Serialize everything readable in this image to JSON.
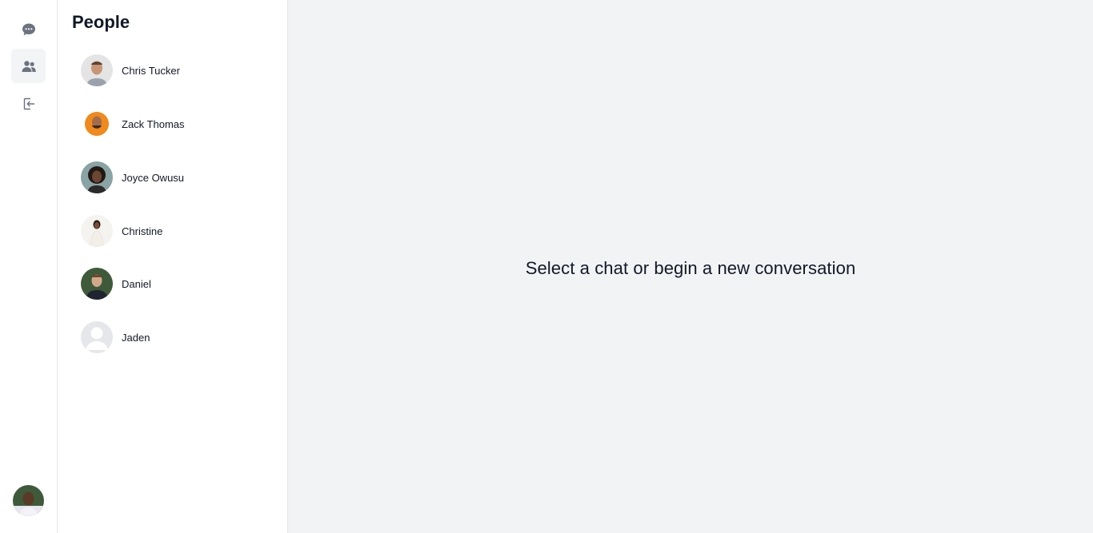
{
  "rail": {
    "items": [
      {
        "icon": "chat-bubble-icon",
        "active": false
      },
      {
        "icon": "people-icon",
        "active": true
      },
      {
        "icon": "logout-icon",
        "active": false
      }
    ],
    "icon_color": "#6b7280"
  },
  "panel": {
    "title": "People",
    "people": [
      {
        "name": "Chris Tucker"
      },
      {
        "name": "Zack Thomas"
      },
      {
        "name": "Joyce Owusu"
      },
      {
        "name": "Christine"
      },
      {
        "name": "Daniel"
      },
      {
        "name": "Jaden"
      }
    ]
  },
  "main": {
    "empty_message": "Select a chat or begin a new conversation",
    "background": "#f2f3f5"
  }
}
